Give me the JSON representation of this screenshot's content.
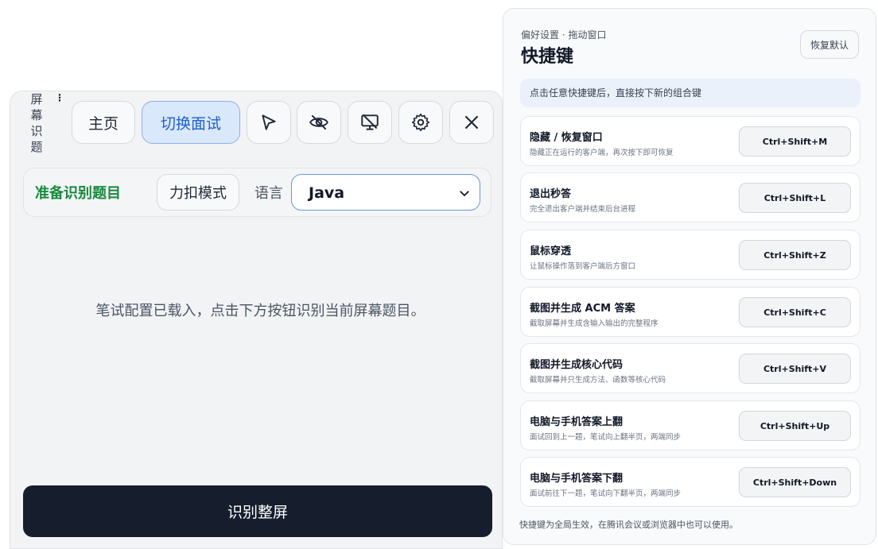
{
  "main_window": {
    "brand_vertical": [
      "屏",
      "幕",
      "识",
      "题"
    ],
    "grip_icon": "drag-handle",
    "toolbar": {
      "home_label": "主页",
      "switch_mode_label": "切换面试",
      "icons": [
        "pointer-icon",
        "eye-off-icon",
        "monitor-off-icon",
        "gear-icon",
        "close-icon"
      ]
    },
    "mode_row": {
      "status": "准备识别题目",
      "mode_button": "力扣模式",
      "language_label": "语言",
      "language_value": "Java"
    },
    "hint_text": "笔试配置已载入，点击下方按钮识别当前屏幕题目。",
    "scan_button": "识别整屏"
  },
  "settings_panel": {
    "subtitle": "偏好设置 · 拖动窗口",
    "title": "快捷键",
    "reset_button": "恢复默认",
    "notice": "点击任意快捷键后，直接按下新的组合键",
    "shortcuts": [
      {
        "name": "隐藏 / 恢复窗口",
        "desc": "隐藏正在运行的客户端，再次按下即可恢复",
        "keys": "Ctrl+Shift+M"
      },
      {
        "name": "退出秒答",
        "desc": "完全退出客户端并结束后台进程",
        "keys": "Ctrl+Shift+L"
      },
      {
        "name": "鼠标穿透",
        "desc": "让鼠标操作落到客户端后方窗口",
        "keys": "Ctrl+Shift+Z"
      },
      {
        "name": "截图并生成 ACM 答案",
        "desc": "截取屏幕并生成含输入输出的完整程序",
        "keys": "Ctrl+Shift+C"
      },
      {
        "name": "截图并生成核心代码",
        "desc": "截取屏幕并只生成方法、函数等核心代码",
        "keys": "Ctrl+Shift+V"
      },
      {
        "name": "电脑与手机答案上翻",
        "desc": "面试回到上一题，笔试向上翻半页，两端同步",
        "keys": "Ctrl+Shift+Up"
      },
      {
        "name": "电脑与手机答案下翻",
        "desc": "面试前往下一题，笔试向下翻半页，两端同步",
        "keys": "Ctrl+Shift+Down"
      }
    ],
    "footer": "快捷键为全局生效，在腾讯会议或浏览器中也可以使用。"
  },
  "colors": {
    "accent_blue": "#1d5fd0",
    "status_green": "#178a3d",
    "scan_button_bg": "#161d2c"
  }
}
